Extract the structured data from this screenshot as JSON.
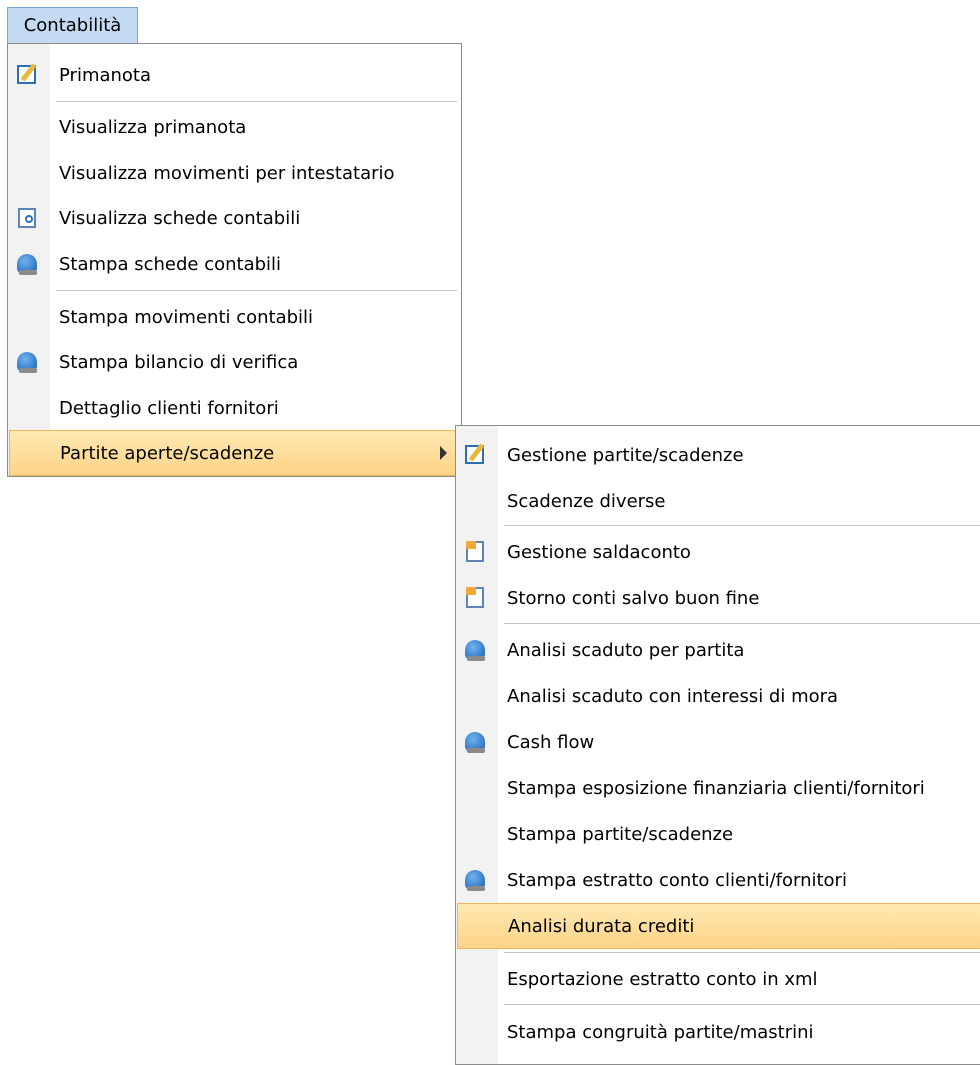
{
  "menubar": {
    "title": "Contabilità"
  },
  "main_menu": {
    "items": [
      {
        "label": "Primanota",
        "icon": "edit-icon"
      },
      {
        "label": "Visualizza primanota",
        "icon": ""
      },
      {
        "label": "Visualizza movimenti per intestatario",
        "icon": ""
      },
      {
        "label": "Visualizza schede contabili",
        "icon": "view-document-icon"
      },
      {
        "label": "Stampa schede contabili",
        "icon": "print-icon"
      },
      {
        "label": "Stampa movimenti contabili",
        "icon": ""
      },
      {
        "label": "Stampa bilancio di verifica",
        "icon": "print-icon"
      },
      {
        "label": "Dettaglio clienti fornitori",
        "icon": ""
      },
      {
        "label": "Partite aperte/scadenze",
        "icon": "",
        "submenu": true
      }
    ]
  },
  "submenu": {
    "items": [
      {
        "label": "Gestione partite/scadenze",
        "icon": "edit-icon"
      },
      {
        "label": "Scadenze diverse",
        "icon": ""
      },
      {
        "label": "Gestione saldaconto",
        "icon": "document-icon"
      },
      {
        "label": "Storno conti salvo buon fine",
        "icon": "document-icon"
      },
      {
        "label": "Analisi scaduto per partita",
        "icon": "print-icon"
      },
      {
        "label": "Analisi scaduto con interessi di mora",
        "icon": ""
      },
      {
        "label": "Cash flow",
        "icon": "print-icon"
      },
      {
        "label": "Stampa esposizione finanziaria clienti/fornitori",
        "icon": ""
      },
      {
        "label": "Stampa partite/scadenze",
        "icon": ""
      },
      {
        "label": "Stampa estratto conto clienti/fornitori",
        "icon": "print-icon"
      },
      {
        "label": "Analisi durata crediti",
        "icon": ""
      },
      {
        "label": "Esportazione estratto conto in xml",
        "icon": ""
      },
      {
        "label": "Stampa congruità partite/mastrini",
        "icon": ""
      }
    ]
  },
  "colors": {
    "highlight": "#fdd387",
    "highlight_border": "#efb55a",
    "menubar_active": "#c4daf2"
  }
}
